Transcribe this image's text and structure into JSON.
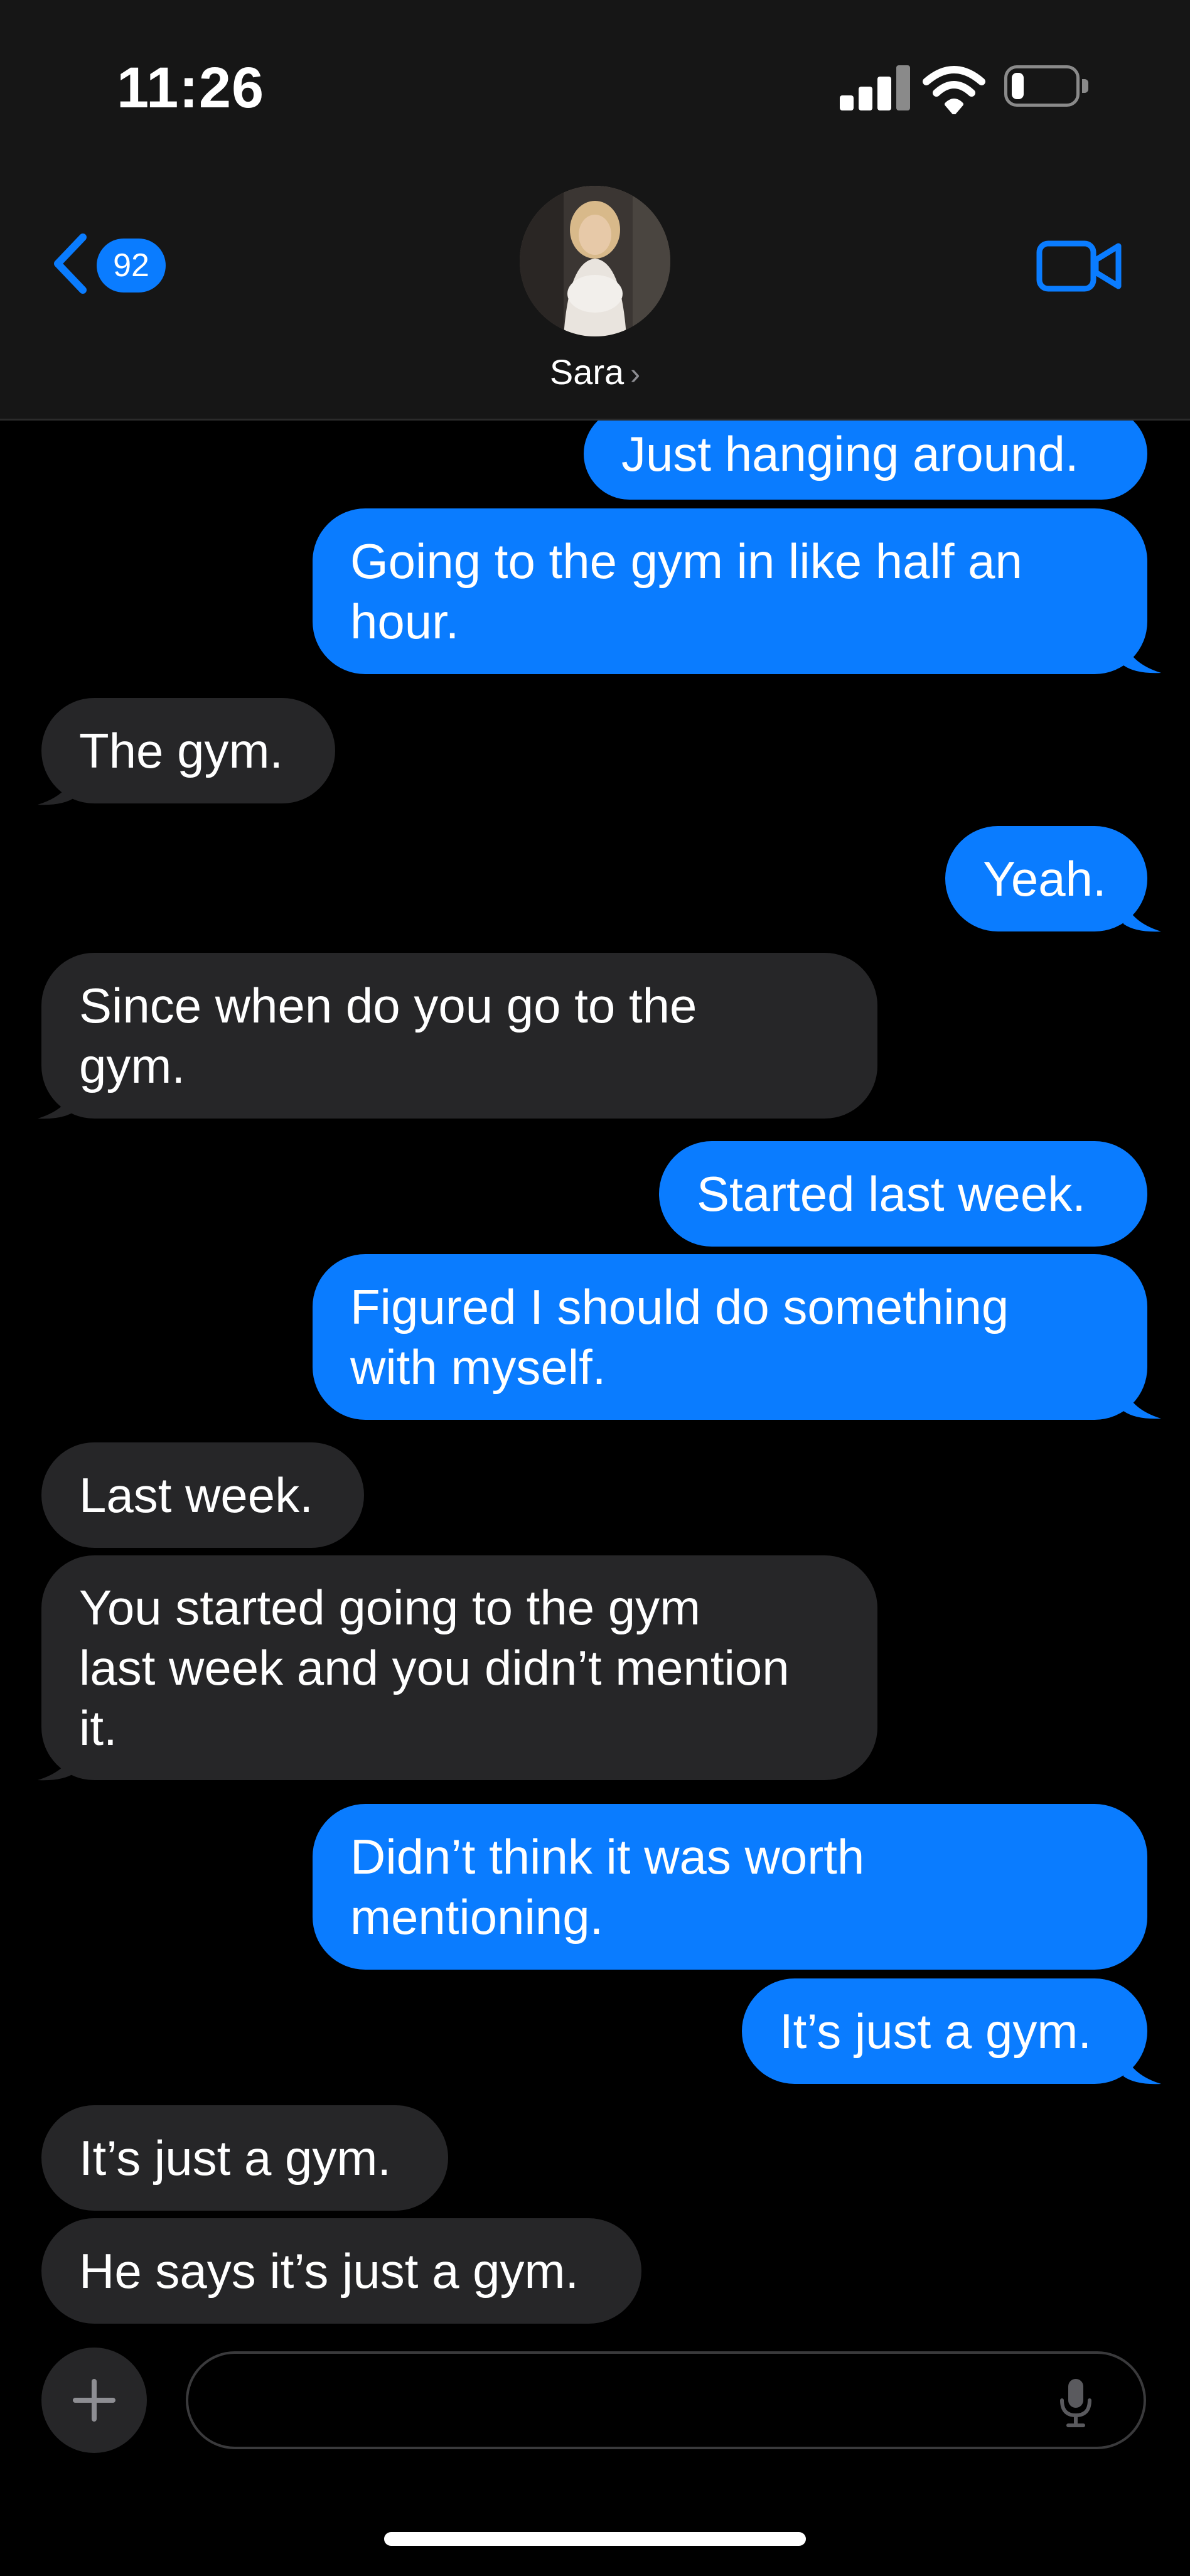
{
  "status_bar": {
    "time": "11:26",
    "signal_icon": "cellular-signal-icon",
    "wifi_icon": "wifi-icon",
    "battery_icon": "battery-icon",
    "battery_level": 0.2
  },
  "header": {
    "back_icon": "chevron-left-icon",
    "unread_count": "92",
    "contact_name": "Sara",
    "contact_chevron": "›",
    "avatar_icon": "contact-avatar",
    "video_icon": "video-camera-icon",
    "background": "#161616"
  },
  "messages": [
    {
      "from": "me",
      "text": "Just hanging around."
    },
    {
      "from": "me",
      "text": "Going to the gym in like half an\nhour."
    },
    {
      "from": "them",
      "text": "The gym."
    },
    {
      "from": "me",
      "text": "Yeah."
    },
    {
      "from": "them",
      "text": "Since when do you go to the\ngym."
    },
    {
      "from": "me",
      "text": "Started last week."
    },
    {
      "from": "me",
      "text": "Figured I should do something\nwith myself."
    },
    {
      "from": "them",
      "text": "Last week."
    },
    {
      "from": "them",
      "text": "You started going to the gym\nlast week and you didn’t mention\nit."
    },
    {
      "from": "me",
      "text": "Didn’t think it was worth\nmentioning."
    },
    {
      "from": "me",
      "text": "It’s just a gym."
    },
    {
      "from": "them",
      "text": "It’s just a gym."
    },
    {
      "from": "them",
      "text": "He says it’s just a gym."
    }
  ],
  "composer": {
    "plus_icon": "plus-icon",
    "message_value": "",
    "placeholder": "",
    "mic_icon": "microphone-icon"
  },
  "colors": {
    "sent_bubble": "#0a7cff",
    "received_bubble": "#262628",
    "background": "#000000",
    "accent": "#0a7cff"
  }
}
